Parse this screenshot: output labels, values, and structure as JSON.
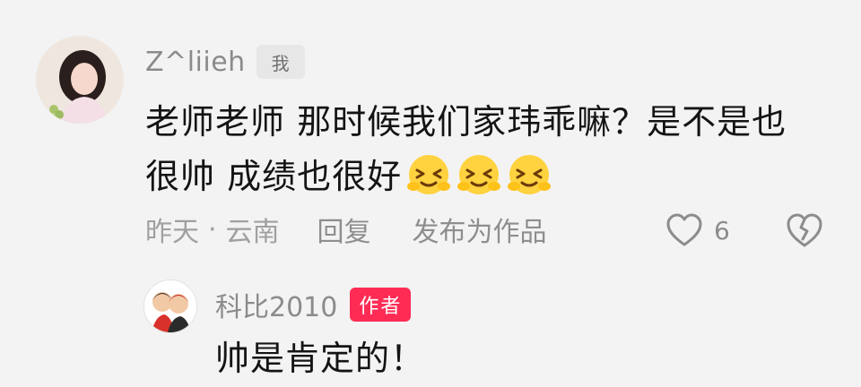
{
  "comment": {
    "username": "Z^liieh",
    "me_badge": "我",
    "text_line1": "老师老师 那时候我们家玮乖嘛？是不是也",
    "text_line2": "很帅 成绩也很好",
    "emojis": [
      "laughing-tears-emoji",
      "laughing-tears-emoji",
      "laughing-tears-emoji"
    ],
    "meta": {
      "time": "昨天",
      "separator": "·",
      "location": "云南",
      "reply_label": "回复",
      "publish_label": "发布为作品"
    },
    "likes": {
      "icon": "heart-outline-icon",
      "count": "6"
    },
    "dislike_icon": "broken-heart-icon"
  },
  "reply": {
    "username": "科比2010",
    "author_badge": "作者",
    "text": "帅是肯定的！"
  },
  "colors": {
    "background": "#f3f3f3",
    "author_badge": "#fe2c55",
    "secondary_text": "#8b8b8b",
    "primary_text": "#141414"
  }
}
